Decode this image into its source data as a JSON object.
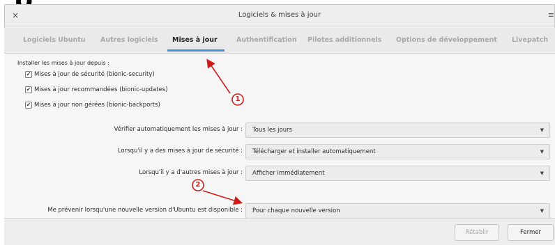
{
  "window": {
    "title": "Logiciels & mises à jour",
    "close_glyph": "×",
    "menu_glyph": "≡",
    "partial_heading": "p"
  },
  "tabs": [
    {
      "label": "Logiciels Ubuntu",
      "active": false
    },
    {
      "label": "Autres logiciels",
      "active": false
    },
    {
      "label": "Mises à jour",
      "active": true
    },
    {
      "label": "Authentification",
      "active": false
    },
    {
      "label": "Pilotes additionnels",
      "active": false
    },
    {
      "label": "Options de développement",
      "active": false
    },
    {
      "label": "Livepatch",
      "active": false
    }
  ],
  "updates": {
    "install_from_label": "Installer les mises à jour depuis :",
    "sources": [
      {
        "label": "Mises à jour de sécurité (bionic-security)",
        "checked": true
      },
      {
        "label": "Mises à jour recommandées (bionic-updates)",
        "checked": true
      },
      {
        "label": "Mises à jour non gérées (bionic-backports)",
        "checked": true
      }
    ],
    "settings": [
      {
        "label": "Vérifier automatiquement les mises à jour :",
        "value": "Tous les jours"
      },
      {
        "label": "Lorsqu'il y a des mises à jour de sécurité :",
        "value": "Télécharger et installer automatiquement"
      },
      {
        "label": "Lorsqu'il y a d'autres mises à jour :",
        "value": "Afficher immédiatement"
      },
      {
        "label": "Me prévenir lorsqu'une nouvelle version d'Ubuntu est disponible :",
        "value": "Pour chaque nouvelle version"
      }
    ]
  },
  "buttons": {
    "revert_label": "Rétablir",
    "close_label": "Fermer"
  },
  "annotations": [
    {
      "number": "1"
    },
    {
      "number": "2"
    }
  ],
  "colors": {
    "annotation_red": "#d11b1b",
    "tab_underline": "#4a90d9"
  },
  "icons": {
    "combo_arrow": "▼",
    "check_mark": "✔"
  }
}
